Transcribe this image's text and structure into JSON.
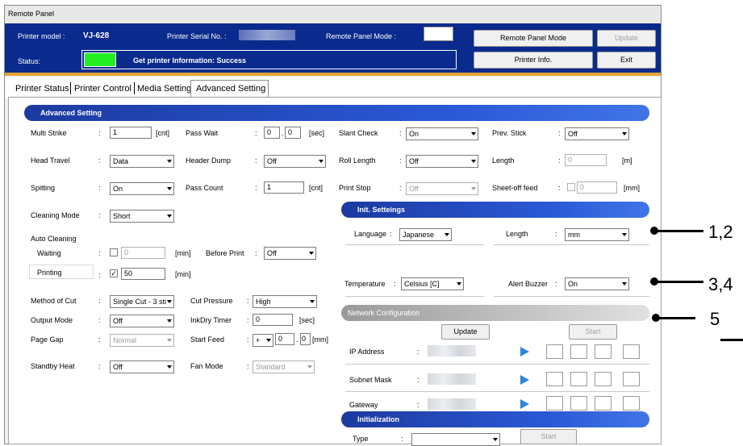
{
  "window": {
    "title": "Remote Panel"
  },
  "header": {
    "printer_model_label": "Printer model :",
    "printer_model_value": "VJ-628",
    "serial_label": "Printer Serial No. :",
    "remote_panel_mode_label": "Remote Panel Mode :",
    "status_label": "Status:",
    "status_text": "Get printer Information: Success",
    "status_color": "#22ee22",
    "buttons": {
      "remote_panel_mode": "Remote Panel Mode",
      "update": "Update",
      "printer_info": "Printer Info.",
      "exit": "Exit"
    }
  },
  "tabs": [
    "Printer Status",
    "Printer Control",
    "Media Setting",
    "Advanced Setting"
  ],
  "advanced": {
    "header": "Advanced Setting",
    "multi_strike": {
      "label": "Multi Strike",
      "value": "1",
      "unit": "[cnt]"
    },
    "pass_wait": {
      "label": "Pass Wait",
      "value1": "0",
      "value2": "0",
      "unit": "[sec]"
    },
    "slant_check": {
      "label": "Slant Check",
      "value": "On"
    },
    "prev_stick": {
      "label": "Prev. Stick",
      "value": "Off"
    },
    "head_travel": {
      "label": "Head Travel",
      "value": "Data"
    },
    "header_dump": {
      "label": "Header Dump",
      "value": "Off"
    },
    "roll_length": {
      "label": "Roll Length",
      "value": "Off"
    },
    "length": {
      "label": "Length",
      "value": "0",
      "unit": "[m]"
    },
    "spitting": {
      "label": "Spitting",
      "value": "On"
    },
    "pass_count": {
      "label": "Pass Count",
      "value": "1",
      "unit": "[cnt]"
    },
    "print_stop": {
      "label": "Print Stop",
      "value": "Off"
    },
    "sheet_off_feed": {
      "label": "Sheet-off feed",
      "value": "0",
      "unit": "[mm]"
    },
    "cleaning_mode": {
      "label": "Cleaning Mode",
      "value": "Short"
    },
    "auto_cleaning": {
      "label": "Auto Cleaning"
    },
    "waiting": {
      "label": "Waiting",
      "value": "0",
      "unit": "[min]"
    },
    "before_print": {
      "label": "Before Print",
      "value": "Off"
    },
    "printing": {
      "label": "Printing",
      "value": "50",
      "unit": "[min]",
      "check": "✓"
    },
    "method_of_cut": {
      "label": "Method of Cut",
      "value": "Single Cut - 3 sti"
    },
    "cut_pressure": {
      "label": "Cut Pressure",
      "value": "High"
    },
    "output_mode": {
      "label": "Output Mode",
      "value": "Off"
    },
    "inkdry_timer": {
      "label": "InkDry Timer",
      "value": "0",
      "unit": "[sec]"
    },
    "page_gap": {
      "label": "Page Gap",
      "value": "Normal"
    },
    "start_feed": {
      "label": "Start Feed",
      "sign": "+",
      "value1": "0",
      "value2": "0",
      "unit": "[mm]"
    },
    "standby_heat": {
      "label": "Standby Heat",
      "value": "Off"
    },
    "fan_mode": {
      "label": "Fan Mode",
      "value": "Standard"
    }
  },
  "init_settings": {
    "header": "Init. Setteings",
    "language": {
      "label": "Language",
      "value": "Japanese"
    },
    "length": {
      "label": "Length",
      "value": "mm"
    },
    "temperature": {
      "label": "Temperature",
      "value": "Celsius [C]"
    },
    "alert_buzzer": {
      "label": "Alert Buzzer",
      "value": "On"
    }
  },
  "network": {
    "header": "Network Configuration",
    "update": "Update",
    "start": "Start",
    "ip_address": "IP Address",
    "subnet_mask": "Subnet Mask",
    "gateway": "Gateway"
  },
  "initialization": {
    "header": "Initialization",
    "type_label": "Type",
    "start": "Start"
  },
  "annotations": {
    "a1": "1,2",
    "a2": "3,4",
    "a3": "5"
  },
  "separators": {
    "colon": ":",
    "dot": "."
  }
}
